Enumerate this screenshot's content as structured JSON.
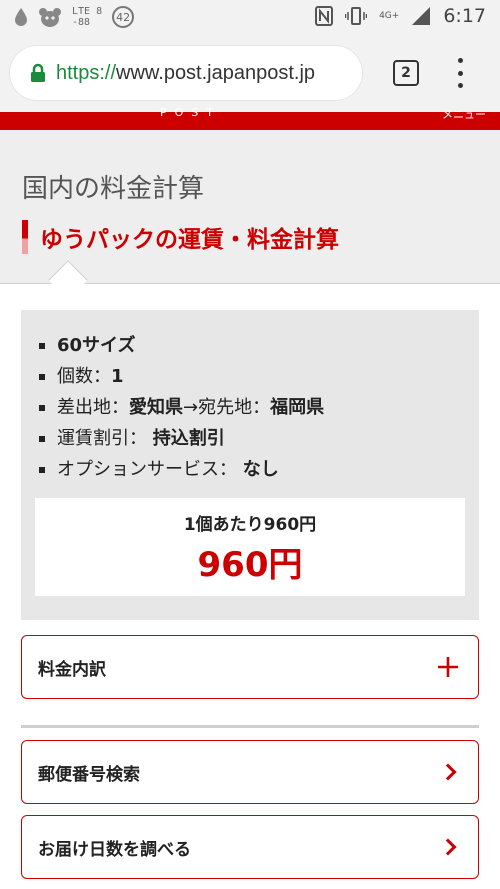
{
  "status_bar": {
    "lte_label": "LTE 8",
    "lte_sub": "-88",
    "badge_count": "42",
    "network_label": "4G+",
    "time": "6:17"
  },
  "browser": {
    "url_scheme": "https://",
    "url_host": "www.post.japanpost.jp",
    "tab_count": "2"
  },
  "header_strip": {
    "logo_text": "POST",
    "right_text": "メニュー"
  },
  "page": {
    "title": "国内の料金計算",
    "subtitle": "ゆうパックの運賃・料金計算"
  },
  "summary": {
    "size": "60サイズ",
    "quantity_label": "個数：",
    "quantity_value": "1",
    "origin_label": "差出地：",
    "origin_value": "愛知県",
    "arrow": " → ",
    "dest_label": "宛先地：",
    "dest_value": "福岡県",
    "discount_label": "運賃割引：",
    "discount_value": "持込割引",
    "option_label": "オプションサービス：",
    "option_value": "なし",
    "unit_price": "1個あたり960円",
    "total_price": "960円"
  },
  "breakdown": {
    "label": "料金内訳",
    "icon": "plus-icon"
  },
  "links": [
    {
      "label": "郵便番号検索",
      "icon": "chevron-right-icon"
    },
    {
      "label": "お届け日数を調べる",
      "icon": "chevron-right-icon"
    }
  ],
  "colors": {
    "brand_red": "#cc0000",
    "panel_gray": "#e7e7e7",
    "secure_green": "#1a8b3b"
  }
}
